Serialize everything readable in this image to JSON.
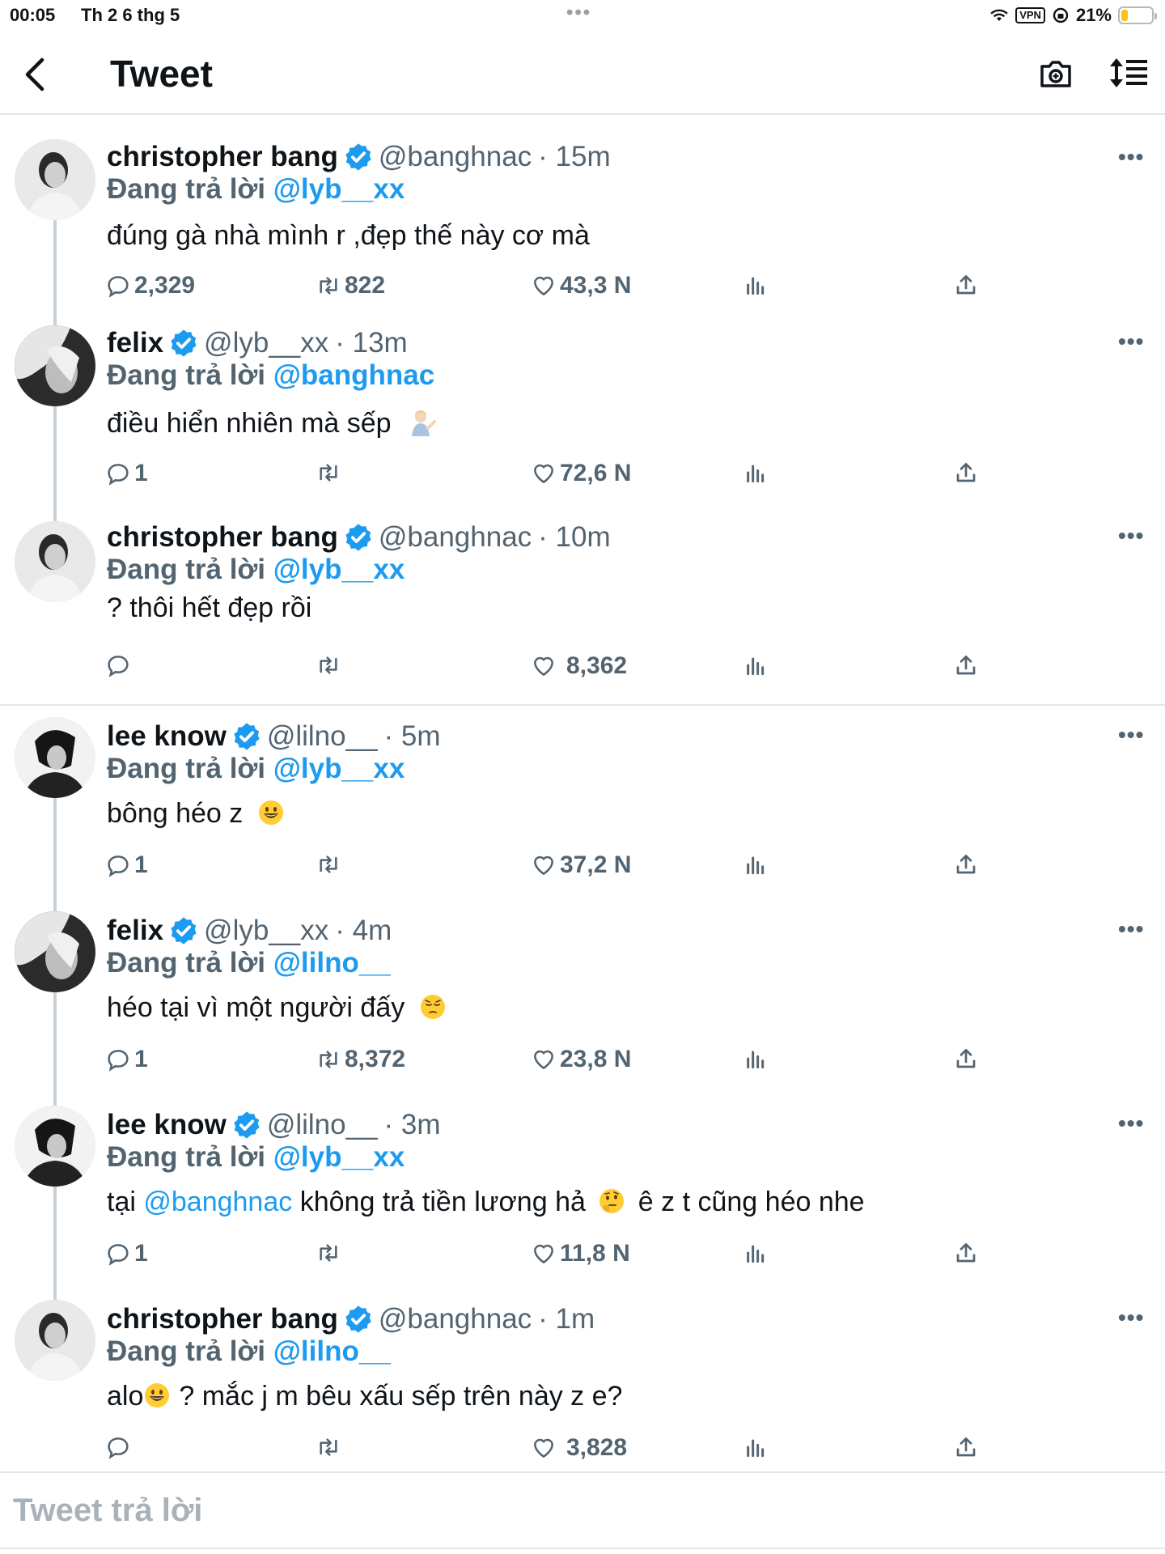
{
  "status_bar": {
    "time": "00:05",
    "date": "Th 2 6 thg 5",
    "vpn": "VPN",
    "battery": "21%",
    "battery_level": 0.21
  },
  "header": {
    "title": "Tweet",
    "back_icon": "chevron-left-icon",
    "camera_icon": "camera-icon",
    "sort_icon": "sort-icon"
  },
  "colors": {
    "accent": "#1d9bf0",
    "text": "#0f1419",
    "muted": "#536471",
    "divider": "#e1e6ea"
  },
  "tweets": [
    {
      "name": "christopher bang",
      "handle": "@banghnac",
      "time": "· 15m",
      "reply_label": "Đang trả lời",
      "reply_to": "@lyb__xx",
      "text": "đúng gà nhà mình r ,đẹp thế này cơ mà",
      "replies": "2,329",
      "retweets": "822",
      "likes": "43,3 N"
    },
    {
      "name": "felix",
      "handle": "@lyb__xx",
      "time": "· 13m",
      "reply_label": "Đang trả lời",
      "reply_to": "@banghnac",
      "text": "điều hiển nhiên mà sếp",
      "emoji": "person-tipping-hand-emoji",
      "replies": "1",
      "retweets": "",
      "likes": "72,6 N"
    },
    {
      "name": "christopher bang",
      "handle": "@banghnac",
      "time": "· 10m",
      "reply_label": "Đang trả lời",
      "reply_to": "@lyb__xx",
      "text": "? thôi hết đẹp rồi",
      "replies": "",
      "retweets": "",
      "likes": "8,362"
    },
    {
      "name": "lee know",
      "handle": "@lilno__",
      "time": "· 5m",
      "reply_label": "Đang trả lời",
      "reply_to": "@lyb__xx",
      "text": "bông héo z",
      "emoji": "grinning-face-emoji",
      "replies": "1",
      "retweets": "",
      "likes": "37,2 N"
    },
    {
      "name": "felix",
      "handle": "@lyb__xx",
      "time": "· 4m",
      "reply_label": "Đang trả lời",
      "reply_to": "@lilno__",
      "text": "héo tại vì một người đấy",
      "emoji": "pensive-face-emoji",
      "replies": "1",
      "retweets": "8,372",
      "likes": "23,8 N"
    },
    {
      "name": "lee know",
      "handle": "@lilno__",
      "time": "· 3m",
      "reply_label": "Đang trả lời",
      "reply_to": "@lyb__xx",
      "text_pre": "tại",
      "text_mention": "@banghnac",
      "text_mid": "không trả tiền lương hả",
      "text_post": "ê z t cũng héo nhe",
      "emoji": "thinking-face-emoji",
      "replies": "1",
      "retweets": "",
      "likes": "11,8 N"
    },
    {
      "name": "christopher bang",
      "handle": "@banghnac",
      "time": "· 1m",
      "reply_label": "Đang trả lời",
      "reply_to": "@lilno__",
      "text_pre": "alo",
      "text_post": "?  mắc j m bêu xấu sếp trên này z e?",
      "emoji": "grinning-face-emoji",
      "replies": "",
      "retweets": "",
      "likes": "3,828"
    }
  ],
  "composer": {
    "placeholder": "Tweet trả lời"
  }
}
